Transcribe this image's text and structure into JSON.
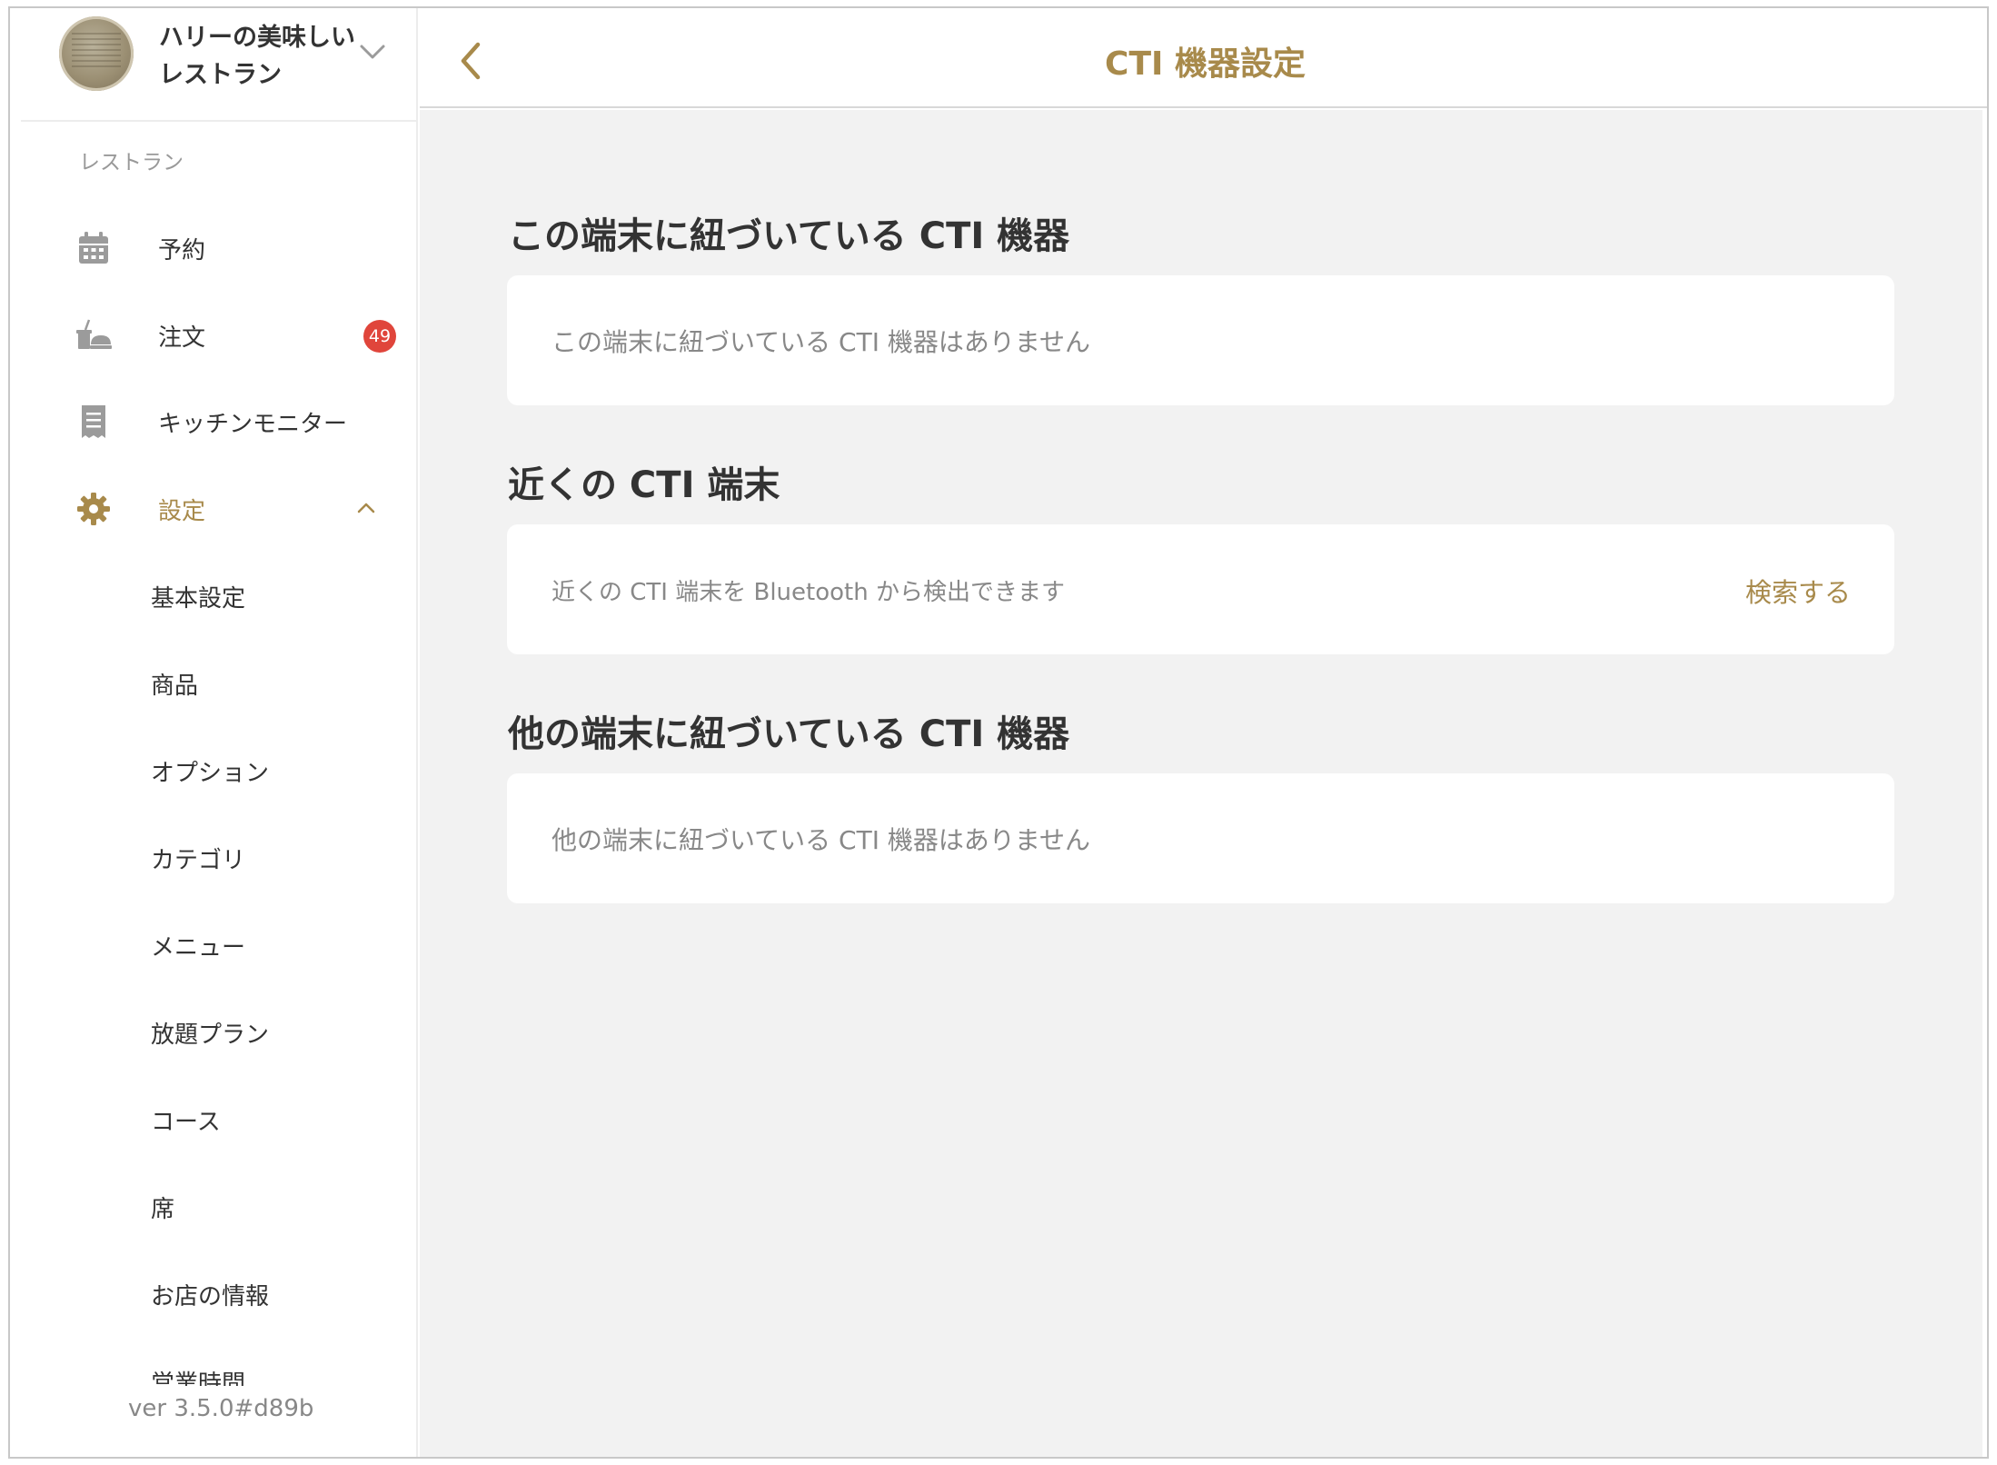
{
  "sidebar": {
    "store_name_line1": "ハリーの美味しい",
    "store_name_line2": "レストラン",
    "section_label": "レストラン",
    "items": [
      {
        "label": "予約",
        "icon": "calendar-icon"
      },
      {
        "label": "注文",
        "icon": "order-tray-icon",
        "badge": "49"
      },
      {
        "label": "キッチンモニター",
        "icon": "receipt-icon"
      },
      {
        "label": "設定",
        "icon": "gear-icon",
        "active": true
      }
    ],
    "settings_subitems": [
      "基本設定",
      "商品",
      "オプション",
      "カテゴリ",
      "メニュー",
      "放題プラン",
      "コース",
      "席",
      "お店の情報",
      "営業時間"
    ],
    "version": "ver 3.5.0#d89b"
  },
  "header": {
    "title": "CTI 機器設定"
  },
  "sections": {
    "linked": {
      "title": "この端末に紐づいている CTI 機器",
      "empty_text": "この端末に紐づいている CTI 機器はありません"
    },
    "nearby": {
      "title": "近くの CTI 端末",
      "description": "近くの CTI 端末を Bluetooth から検出できます",
      "search_label": "検索する"
    },
    "others": {
      "title": "他の端末に紐づいている CTI 機器",
      "empty_text": "他の端末に紐づいている CTI 機器はありません"
    }
  },
  "colors": {
    "accent": "#a88a4b",
    "badge": "#e0453b",
    "icon_gray": "#9b9b9b",
    "background": "#f2f2f2"
  }
}
